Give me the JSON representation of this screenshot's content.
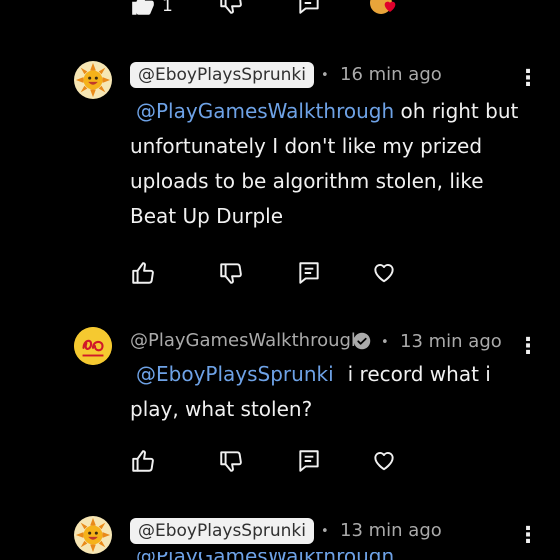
{
  "top_action_bar": {
    "like_count": "1"
  },
  "comments": [
    {
      "author": "@EboyPlaysSprunki",
      "separator": "•",
      "time": "16 min ago",
      "mention": "@PlayGamesWalkthrough",
      "text": "oh right but unfortunately I don't like my prized uploads to be algorithm stolen, like Beat Up Durple"
    },
    {
      "author": "@PlayGamesWalkthrough",
      "separator": "•",
      "time": "13 min ago",
      "mention": "@EboyPlaysSprunki",
      "text": "i record what i play, what stolen?"
    },
    {
      "author": "@EboyPlaysSprunki",
      "separator": "•",
      "time": "13 min ago",
      "mention": "@PlayGamesWalkthrough"
    }
  ],
  "icons": {
    "like": "thumbs-up-icon",
    "dislike": "thumbs-down-icon",
    "reply": "reply-icon",
    "heart": "heart-icon",
    "more": "more-vertical-icon",
    "verified": "verified-icon"
  },
  "colors": {
    "background": "#000000",
    "mention": "#6ea2e6",
    "meta": "#aaaaaa",
    "author_pill_bg": "#f1f1f1",
    "heart_badge": "#e0002b"
  }
}
